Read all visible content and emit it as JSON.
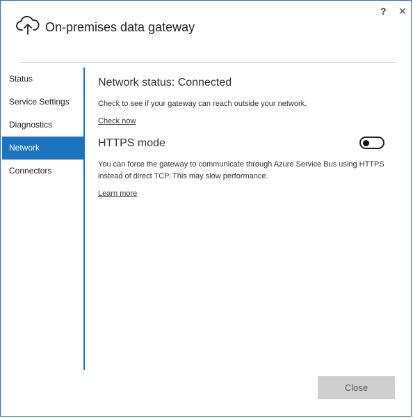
{
  "window": {
    "title": "On-premises data gateway",
    "help_glyph": "?",
    "close_glyph": "✕"
  },
  "sidebar": {
    "items": [
      {
        "label": "Status",
        "active": false
      },
      {
        "label": "Service Settings",
        "active": false
      },
      {
        "label": "Diagnostics",
        "active": false
      },
      {
        "label": "Network",
        "active": true
      },
      {
        "label": "Connectors",
        "active": false
      }
    ]
  },
  "network": {
    "status_title": "Network status: Connected",
    "status_desc": "Check to see if your gateway can reach outside your network.",
    "check_now_link": "Check now",
    "https_title": "HTTPS mode",
    "https_enabled": false,
    "https_desc": "You can force the gateway to communicate through Azure Service Bus using HTTPS instead of direct TCP. This may slow performance.",
    "learn_more_link": "Learn more"
  },
  "footer": {
    "close_label": "Close"
  },
  "colors": {
    "accent": "#1e73be",
    "button_bg": "#cfcfcf"
  },
  "icons": {
    "app": "cloud-upload-icon"
  }
}
